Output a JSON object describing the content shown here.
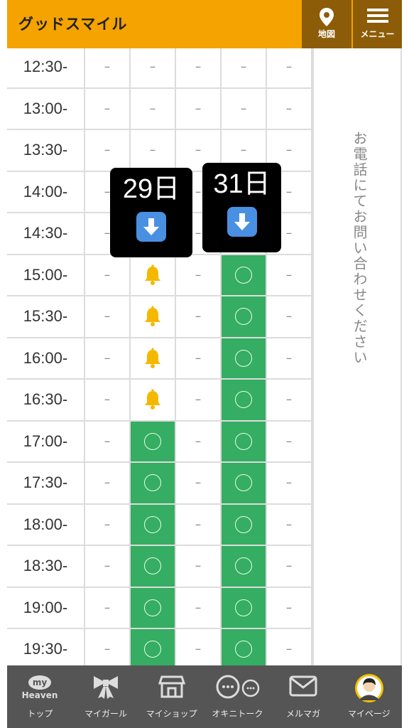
{
  "header": {
    "brand": "グッドスマイル",
    "map_label": "地図",
    "menu_label": "メニュー"
  },
  "schedule": {
    "rows": [
      {
        "time": "12:30-",
        "slots": [
          "dash",
          "dash",
          "dash",
          "dash",
          "dash"
        ]
      },
      {
        "time": "13:00-",
        "slots": [
          "dash",
          "dash",
          "dash",
          "dash",
          "dash"
        ]
      },
      {
        "time": "13:30-",
        "slots": [
          "dash",
          "dash",
          "dash",
          "dash",
          "dash"
        ]
      },
      {
        "time": "14:00-",
        "slots": [
          "dash",
          "dash",
          "dash",
          "dash",
          "dash"
        ]
      },
      {
        "time": "14:30-",
        "slots": [
          "dash",
          "dash",
          "dash",
          "dash",
          "dash"
        ]
      },
      {
        "time": "15:00-",
        "slots": [
          "dash",
          "bell",
          "dash",
          "open",
          "dash"
        ]
      },
      {
        "time": "15:30-",
        "slots": [
          "dash",
          "bell",
          "dash",
          "open",
          "dash"
        ]
      },
      {
        "time": "16:00-",
        "slots": [
          "dash",
          "bell",
          "dash",
          "open",
          "dash"
        ]
      },
      {
        "time": "16:30-",
        "slots": [
          "dash",
          "bell",
          "dash",
          "open",
          "dash"
        ]
      },
      {
        "time": "17:00-",
        "slots": [
          "dash",
          "open",
          "dash",
          "open",
          "dash"
        ]
      },
      {
        "time": "17:30-",
        "slots": [
          "dash",
          "open",
          "dash",
          "open",
          "dash"
        ]
      },
      {
        "time": "18:00-",
        "slots": [
          "dash",
          "open",
          "dash",
          "open",
          "dash"
        ]
      },
      {
        "time": "18:30-",
        "slots": [
          "dash",
          "open",
          "dash",
          "open",
          "dash"
        ]
      },
      {
        "time": "19:00-",
        "slots": [
          "dash",
          "open",
          "dash",
          "open",
          "dash"
        ]
      },
      {
        "time": "19:30-",
        "slots": [
          "dash",
          "open",
          "dash",
          "open",
          "dash"
        ]
      }
    ],
    "dash_text": "–",
    "side_note": "お電話にてお問い合わせください"
  },
  "popups": [
    {
      "day": "29日"
    },
    {
      "day": "31日"
    }
  ],
  "bottom_nav": [
    {
      "label": "トップ",
      "icon": "my-heaven-icon"
    },
    {
      "label": "マイガール",
      "icon": "ribbon-icon"
    },
    {
      "label": "マイショップ",
      "icon": "shop-icon"
    },
    {
      "label": "オキニトーク",
      "icon": "chat-icon"
    },
    {
      "label": "メルマガ",
      "icon": "mail-icon"
    },
    {
      "label": "マイページ",
      "icon": "avatar-icon"
    }
  ],
  "colors": {
    "header": "#f4a300",
    "header_button": "#8c5c08",
    "open_slot": "#35ad62",
    "bell": "#f5b800",
    "nav_bg": "#555555"
  }
}
